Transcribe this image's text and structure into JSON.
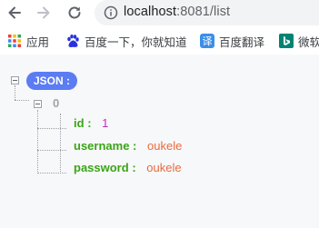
{
  "browser": {
    "url_host": "localhost",
    "url_rest": ":8081/list"
  },
  "bookmarks": [
    {
      "label": "应用",
      "icon": "apps-grid-icon"
    },
    {
      "label": "百度一下，你就知道",
      "icon": "baidu-paw-icon"
    },
    {
      "label": "百度翻译",
      "icon": "translate-icon"
    },
    {
      "label": "微软",
      "icon": "bing-icon"
    }
  ],
  "json_viewer": {
    "root_label": "JSON :",
    "item_index": "0",
    "fields": [
      {
        "key": "id",
        "colon": ":",
        "value": "1",
        "type": "number"
      },
      {
        "key": "username",
        "colon": ":",
        "value": "oukele",
        "type": "string"
      },
      {
        "key": "password",
        "colon": ":",
        "value": "oukele",
        "type": "string"
      }
    ],
    "colors": {
      "badge": "#5b7cf2",
      "key": "#3aa515",
      "number": "#c02bc2",
      "string": "#ea6a3f"
    }
  }
}
